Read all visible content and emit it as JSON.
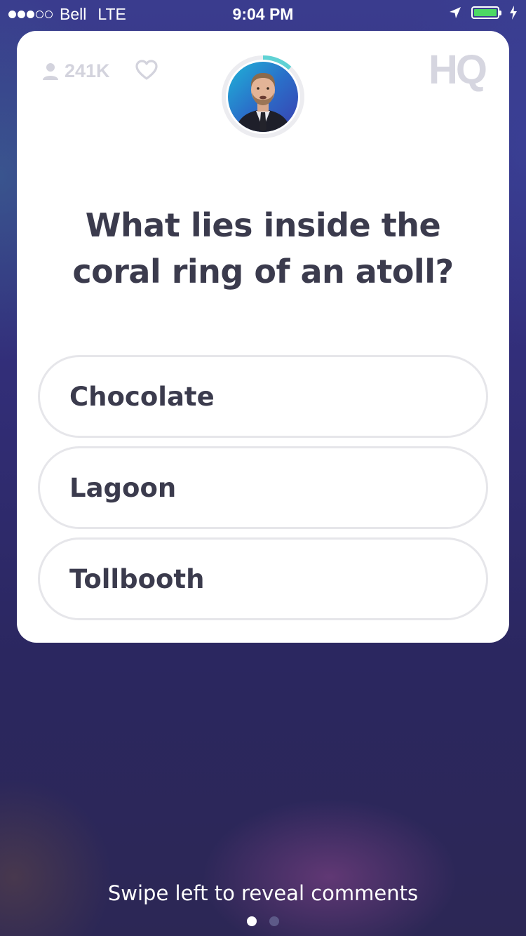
{
  "status_bar": {
    "signal_filled": 3,
    "signal_total": 5,
    "carrier": "Bell",
    "network": "LTE",
    "time": "9:04 PM",
    "location_icon": "location-arrow-icon",
    "battery_level": 1.0,
    "battery_color": "#4cd964",
    "charging_icon": "bolt-icon"
  },
  "header": {
    "viewer_count": "241K",
    "viewer_icon": "person-icon",
    "heart_icon": "heart-outline-icon",
    "logo": "HQ",
    "timer_color": "#5fd2d4",
    "timer_progress": 0.12
  },
  "question": {
    "text": "What lies inside the coral ring of an atoll?"
  },
  "answers": [
    {
      "label": "Chocolate"
    },
    {
      "label": "Lagoon"
    },
    {
      "label": "Tollbooth"
    }
  ],
  "footer": {
    "hint": "Swipe left to reveal comments",
    "page_count": 2,
    "active_page": 1
  }
}
